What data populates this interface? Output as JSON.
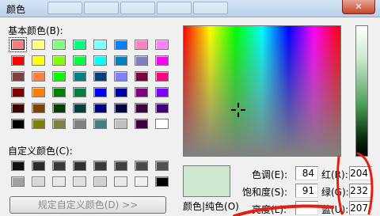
{
  "window": {
    "title": "颜色",
    "close_glyph": "✕"
  },
  "basic_colors": {
    "label": "基本颜色(B):",
    "swatches": [
      "#f08080",
      "#ffff80",
      "#80ff80",
      "#00ff80",
      "#80ffff",
      "#0080ff",
      "#ff80c0",
      "#ff80ff",
      "#ff0000",
      "#ffff00",
      "#80ff00",
      "#00ff40",
      "#00ffff",
      "#0080c0",
      "#8080c0",
      "#ff00ff",
      "#804040",
      "#ff8040",
      "#00ff00",
      "#008080",
      "#004080",
      "#8080ff",
      "#800040",
      "#ff0080",
      "#800000",
      "#ff8000",
      "#008000",
      "#008040",
      "#0000ff",
      "#0000a0",
      "#800080",
      "#8000ff",
      "#400000",
      "#804000",
      "#004000",
      "#004040",
      "#000080",
      "#000040",
      "#400040",
      "#400080",
      "#000000",
      "#808000",
      "#808040",
      "#808080",
      "#408080",
      "#c0c0c0",
      "#400040",
      "#ffffff"
    ]
  },
  "custom_colors": {
    "label": "自定义颜色(C):",
    "swatches": [
      "#101010",
      "#2a2a2a",
      "#3a3a3a",
      "#303030",
      "#3a3a3a",
      "#404040",
      "#4a4a4a",
      "#505050",
      "#a0a0a0",
      "#d8d8d8",
      "#e8e8e8",
      "#e0e0e0",
      "#d0d0d0",
      "#e8e8e8",
      "#f0f0f0",
      "#000000"
    ]
  },
  "define_button": {
    "label": "规定自定义颜色(D) >>"
  },
  "preview": {
    "label": "颜色|纯色(O)",
    "color": "#cce8d0"
  },
  "fields": {
    "hue": {
      "label": "色调(E):",
      "value": "84"
    },
    "sat": {
      "label": "饱和度(S):",
      "value": "91"
    },
    "lum": {
      "label": "亮度(L):",
      "value": ""
    },
    "red": {
      "label": "红(R):",
      "value": "204"
    },
    "green": {
      "label": "绿(G):",
      "value": "232"
    },
    "blue": {
      "label": "蓝(U):",
      "value": "207"
    }
  },
  "annotation_color": "#e02010"
}
